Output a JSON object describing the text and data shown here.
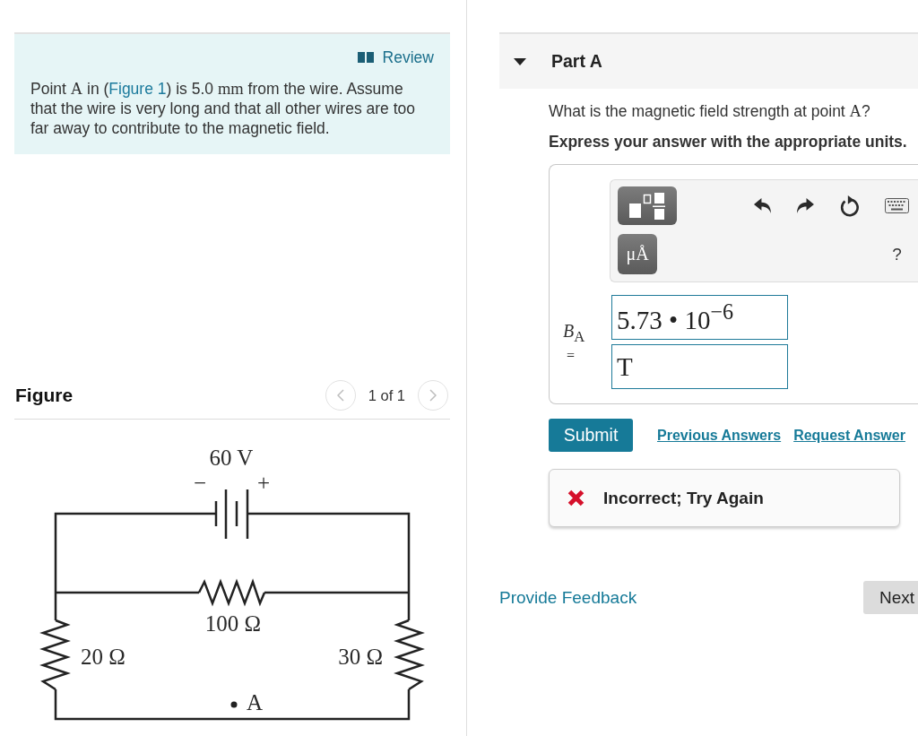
{
  "problem": {
    "review_link": "Review",
    "text": [
      {
        "kind": "text",
        "text": "Point "
      },
      {
        "kind": "math",
        "text": "A"
      },
      {
        "kind": "text",
        "text": " in ("
      },
      {
        "kind": "link",
        "text": "Figure 1"
      },
      {
        "kind": "text",
        "text": ") is 5.0 "
      },
      {
        "kind": "math",
        "text": "mm"
      },
      {
        "kind": "text",
        "text": " from the wire. Assume that the wire is very long and that all other wires are too far away to contribute to the magnetic field."
      }
    ]
  },
  "figure": {
    "heading": "Figure",
    "pager": {
      "label": "1 of 1",
      "previous": {
        "disabled": true
      },
      "next": {
        "disabled": true
      }
    },
    "circuit": {
      "battery": {
        "label": "60 V",
        "negative": "−",
        "positive": "+"
      },
      "resistors": [
        {
          "kind": "middle",
          "label": "100 Ω"
        },
        {
          "kind": "left",
          "label": "20 Ω"
        },
        {
          "kind": "right",
          "label": "30 Ω"
        }
      ],
      "point": "A"
    }
  },
  "part": {
    "title": "Part A",
    "expanded": true,
    "question": [
      {
        "kind": "text",
        "text": "What is the magnetic field strength at point "
      },
      {
        "kind": "math",
        "text": "A"
      },
      {
        "kind": "text",
        "text": "?"
      }
    ],
    "instruction": "Express your answer with the appropriate units.",
    "answer": {
      "toolbar": {
        "units_button": "μÅ",
        "help": "?"
      },
      "variable": "*B*$_{A}$",
      "equals": "=",
      "value": "5.73 • 10$^{−6}$",
      "units": "T"
    },
    "submit": "Submit",
    "links": [
      "Previous Answers",
      "Request Answer"
    ],
    "feedback": {
      "kind": "incorrect",
      "text": "Incorrect; Try Again"
    }
  },
  "footer": {
    "feedback_link": "Provide Feedback",
    "next": "Next"
  }
}
